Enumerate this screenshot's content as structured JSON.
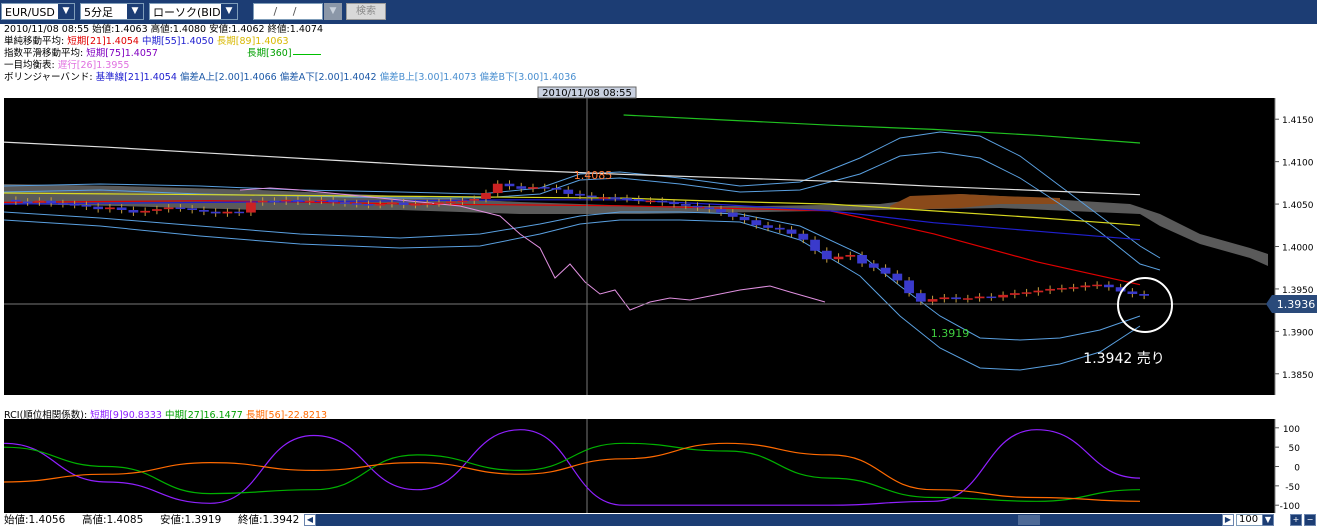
{
  "toolbar": {
    "pair": "EUR/USD",
    "timeframe": "5分足",
    "chart_type": "ローソク(BID)",
    "date_placeholder": "/ /",
    "search_label": "検索"
  },
  "info": {
    "ohlc": "2010/11/08 08:55 始値:1.4063 高値:1.4080 安値:1.4062 終値:1.4074",
    "sma": {
      "label": "単純移動平均:",
      "short": "短期[21]1.4054",
      "mid": "中期[55]1.4050",
      "long": "長期[89]1.4063",
      "long360": "長期[360]"
    },
    "ema": {
      "label": "指数平滑移動平均:",
      "short": "短期[75]1.4057"
    },
    "ichimoku": {
      "label": "一目均衡表:",
      "lag": "遅行[26]1.3955"
    },
    "bollinger": {
      "label": "ボリンジャーバンド:",
      "base": "基準線[21]1.4054",
      "a_up": "偏差A上[2.00]1.4066",
      "a_down": "偏差A下[2.00]1.4042",
      "b_up": "偏差B上[3.00]1.4073",
      "b_down": "偏差B下[3.00]1.4036"
    }
  },
  "chart": {
    "crosshair_time": "2010/11/08 08:55",
    "price_label": "1.3936",
    "high_label": "1.4085",
    "low_label": "1.3919",
    "annotation": "1.3942 売り",
    "colors": {
      "bull": "#cc2222",
      "bear": "#3a3acc",
      "bg": "#000000"
    }
  },
  "rci": {
    "label": "RCI(順位相関係数):",
    "short": "短期[9]90.8333",
    "mid": "中期[27]16.1477",
    "long": "長期[56]-22.8213"
  },
  "status": {
    "open": "始値:1.4056",
    "high": "高値:1.4085",
    "low": "安値:1.3919",
    "close": "終値:1.3942",
    "bars": "100"
  },
  "chart_data": [
    {
      "type": "candlestick",
      "title": "EUR/USD 5分足",
      "y_ticks": [
        1.415,
        1.41,
        1.405,
        1.4,
        1.395,
        1.39,
        1.385
      ],
      "ylim": [
        1.3825,
        1.4175
      ],
      "series": [
        {
          "name": "短期[21]",
          "color": "#e00000",
          "values": [
            1.4052,
            1.4053,
            1.4054,
            1.4052,
            1.405,
            1.4049,
            1.4048,
            1.4045,
            1.4042,
            1.4015,
            1.3982,
            1.3955
          ]
        },
        {
          "name": "中期[55]",
          "color": "#2020d0",
          "values": [
            1.405,
            1.4051,
            1.4052,
            1.4053,
            1.4054,
            1.4055,
            1.4055,
            1.4049,
            1.4042,
            1.4028,
            1.4018,
            1.4008
          ]
        },
        {
          "name": "長期[89]",
          "color": "#d8d820",
          "values": [
            1.4063,
            1.4062,
            1.4061,
            1.406,
            1.4059,
            1.4058,
            1.4057,
            1.4053,
            1.405,
            1.4042,
            1.4034,
            1.4025
          ]
        },
        {
          "name": "長期[360]",
          "color": "#20c020",
          "values": [
            null,
            null,
            null,
            null,
            null,
            null,
            1.4155,
            1.4149,
            1.4143,
            1.4138,
            1.4131,
            1.4122
          ]
        },
        {
          "name": "短期[75]",
          "color": "#e0e0e0",
          "values": [
            1.4123,
            1.4117,
            1.411,
            1.4103,
            1.4096,
            1.409,
            1.4085,
            1.4081,
            1.4077,
            1.4071,
            1.4066,
            1.4061
          ]
        }
      ]
    },
    {
      "type": "line",
      "title": "RCI(順位相関係数)",
      "y_ticks": [
        100,
        50,
        0,
        -50,
        -100
      ],
      "ylim": [
        -115,
        115
      ],
      "series": [
        {
          "name": "短期[9]",
          "color": "#9020ff",
          "values": [
            60,
            -40,
            -95,
            80,
            -60,
            95,
            -100,
            -100,
            -100,
            -90,
            95,
            -30
          ]
        },
        {
          "name": "中期[27]",
          "color": "#00b000",
          "values": [
            50,
            0,
            -70,
            -60,
            30,
            -10,
            60,
            40,
            -30,
            -80,
            -90,
            -60
          ]
        },
        {
          "name": "長期[56]",
          "color": "#ff6a00",
          "values": [
            -40,
            -20,
            10,
            -10,
            10,
            -20,
            20,
            60,
            30,
            -60,
            -80,
            -90
          ]
        }
      ]
    }
  ]
}
